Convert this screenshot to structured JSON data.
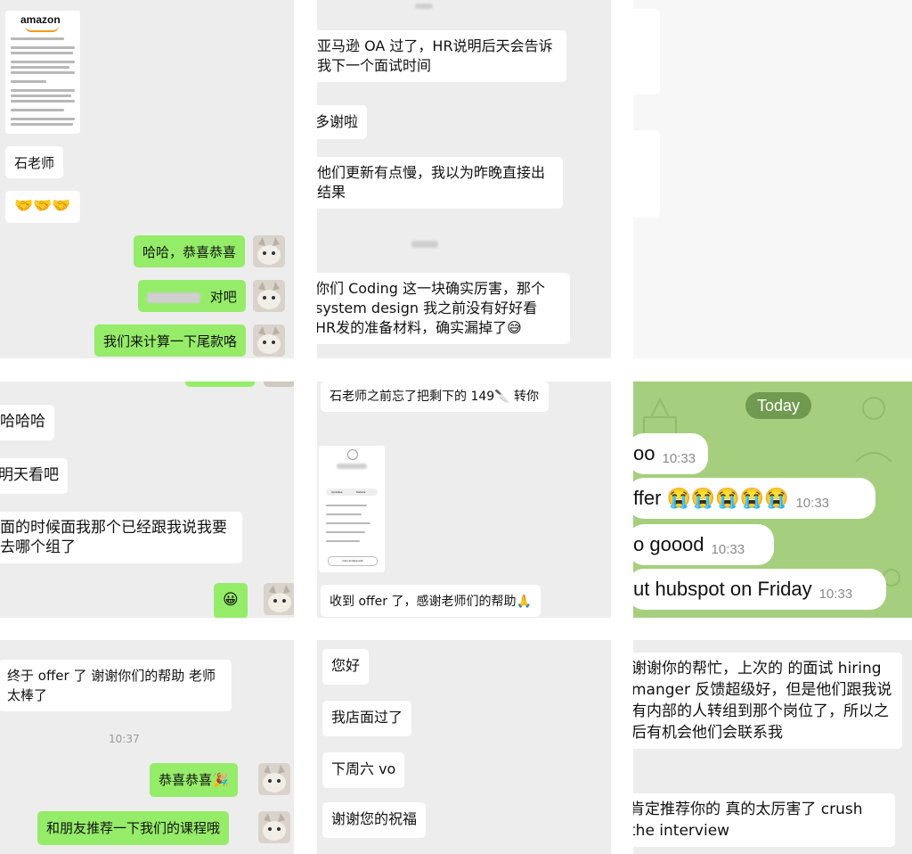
{
  "panel1": {
    "amazon_logo": "amazon",
    "sender_name": "石老师",
    "clap_emojis": "🤝🤝🤝",
    "reply_congrats": "哈哈，恭喜恭喜",
    "reply_blurred_suffix": "对吧",
    "reply_calc": "我们来计算一下尾款咯"
  },
  "panel2": {
    "msg_oa": "亚马逊 OA 过了，HR说明后天会告诉我下一个面试时间",
    "msg_thanks": "多谢啦",
    "msg_slow": "他们更新有点慢，我以为昨晚直接出结果",
    "msg_coding": "你们 Coding 这一块确实厉害，那个 system design 我之前没有好好看 HR发的准备材料，确实漏掉了😅"
  },
  "panel4": {
    "msg_haha": "哈哈哈",
    "msg_tomorrow": "明天看吧",
    "msg_team": "面的时候面我那个已经跟我说我要去哪个组了",
    "smile_emoji": "😀"
  },
  "panel5": {
    "msg_forgot": "石老师之前忘了把剩下的 149🔪 转你",
    "phone_tabs": [
      "Updates",
      "Details"
    ],
    "phone_button": "Cancel Request",
    "msg_offer": "收到 offer 了，感谢老师们的帮助🙏"
  },
  "panel6": {
    "today_label": "Today",
    "messages": [
      {
        "text": "oo",
        "time": "10:33"
      },
      {
        "text": "ffer 😭😭😭😭😭",
        "time": "10:33"
      },
      {
        "text": "o goood",
        "time": "10:33"
      },
      {
        "text": "ut hubspot on Friday",
        "time": "10:33"
      }
    ]
  },
  "panel7": {
    "msg_final": "终于 offer 了 谢谢你们的帮助 老师太棒了",
    "time": "10:37",
    "reply_congrats": "恭喜恭喜🎉",
    "reply_recommend": "和朋友推荐一下我们的课程哦"
  },
  "panel8": {
    "msg_hello": "您好",
    "msg_passed": "我店面过了",
    "msg_vo": "下周六 vo",
    "msg_blessing": "谢谢您的祝福"
  },
  "panel9": {
    "msg_help": "谢谢你的帮忙，上次的 的面试 hiring manger 反馈超级好，但是他们跟我说有内部的人转组到那个岗位了，所以之后有机会他们会联系我",
    "msg_recommend": "肯定推荐你的 真的太厉害了 crush the interview"
  },
  "colors": {
    "wechat_bg": "#ededed",
    "wechat_green": "#95ec69",
    "telegram_green": "#a5cf7e",
    "today_pill": "#6f9a4f"
  }
}
